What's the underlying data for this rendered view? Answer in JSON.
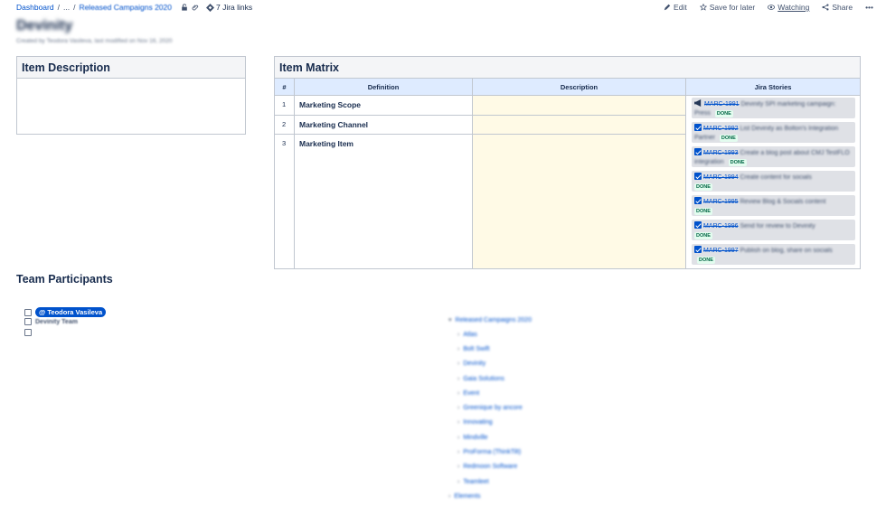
{
  "breadcrumb": {
    "dashboard": "Dashboard",
    "ellipsis": "...",
    "parent": "Released Campaigns 2020",
    "jira_links": "7 Jira links"
  },
  "actions": {
    "edit": "Edit",
    "save": "Save for later",
    "watching": "Watching",
    "share": "Share",
    "more": "•••"
  },
  "page": {
    "title": "Devinity",
    "byline": "Created by Teodora Vasileva, last modified on Nov 16, 2020"
  },
  "item_description": {
    "title": "Item Description"
  },
  "item_matrix": {
    "title": "Item Matrix",
    "headers": [
      "#",
      "Definition",
      "Description",
      "Jira Stories"
    ],
    "rows": [
      {
        "num": "1",
        "definition": "Marketing Scope"
      },
      {
        "num": "2",
        "definition": "Marketing Channel"
      },
      {
        "num": "3",
        "definition": "Marketing Item"
      }
    ],
    "stories": [
      {
        "key": "MARC-1991",
        "summary": "Devinity SPI marketing campaign: Press",
        "status": "DONE",
        "icon": "epic-icon"
      },
      {
        "key": "MARC-1992",
        "summary": "List Devinity as Bolton's Integration Partner",
        "status": "DONE",
        "icon": "task-check-icon"
      },
      {
        "key": "MARC-1993",
        "summary": "Create a blog post about CMJ TestFLO integration",
        "status": "DONE",
        "icon": "task-check-icon"
      },
      {
        "key": "MARC-1994",
        "summary": "Create content for socials",
        "status": "DONE",
        "icon": "task-check-icon"
      },
      {
        "key": "MARC-1995",
        "summary": "Review Blog & Socials content",
        "status": "DONE",
        "icon": "task-check-icon"
      },
      {
        "key": "MARC-1996",
        "summary": "Send for review to Devinity",
        "status": "DONE",
        "icon": "task-check-icon"
      },
      {
        "key": "MARC-1997",
        "summary": "Publish on blog, share on socials",
        "status": "DONE",
        "icon": "task-check-icon"
      }
    ],
    "colors": {
      "header_bg": "#deebff",
      "desc_bg": "#fffae6",
      "link": "#0052cc",
      "done_bg": "#e3fcef",
      "done_text": "#006644"
    }
  },
  "team": {
    "title": "Team Participants",
    "mention": "@ Teodora Vasileva",
    "team_name": "Devinity Team"
  },
  "page_tree": {
    "root": "Released Campaigns 2020",
    "children": [
      "Atlas",
      "Bolt Swift",
      "Devinity",
      "Gaia Solutions",
      "Event",
      "Greenique by ancore",
      "Innovating",
      "Mindville",
      "ProForma (ThinkTilt)",
      "Redmoon Software",
      "Teamleet"
    ],
    "next": "Elements"
  }
}
